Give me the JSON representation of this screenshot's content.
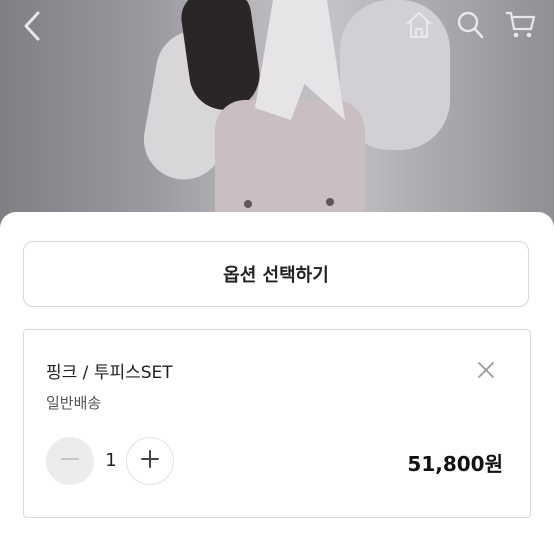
{
  "header": {
    "back_icon": "chevron-left-icon",
    "home_icon": "home-icon",
    "search_icon": "search-icon",
    "cart_icon": "cart-icon"
  },
  "sheet": {
    "select_option_label": "옵션 선택하기",
    "selected_option": {
      "name": "핑크 / 투피스SET",
      "shipping": "일반배송",
      "quantity": "1",
      "price": "51,800원",
      "remove_icon": "close-icon",
      "minus_icon": "minus-icon",
      "plus_icon": "plus-icon"
    }
  },
  "colors": {
    "sheet_background": "#ffffff",
    "border": "#d6d6d6",
    "minus_button_bg": "#ececec"
  }
}
